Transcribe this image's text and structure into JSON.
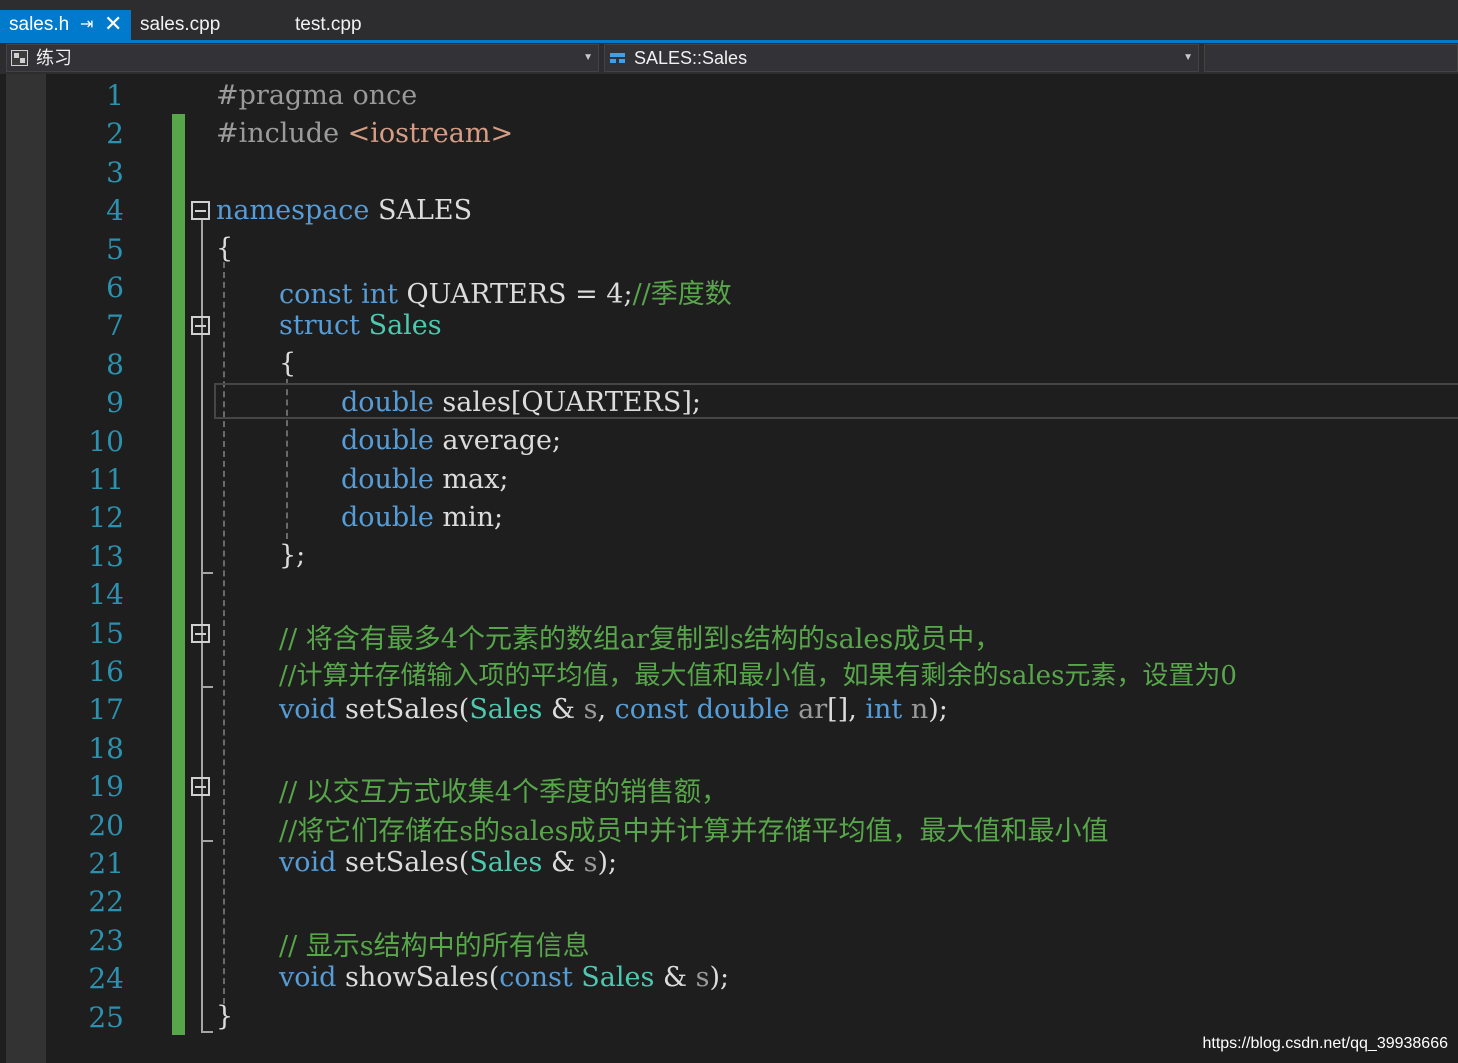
{
  "tabs": [
    {
      "label": "sales.h",
      "active": true
    },
    {
      "label": "sales.cpp",
      "active": false
    },
    {
      "label": "test.cpp",
      "active": false
    }
  ],
  "navbar": {
    "project": "练习",
    "scope": "SALES::Sales",
    "member": ""
  },
  "colors": {
    "accent": "#007acc",
    "keyword": "#569cd6",
    "type": "#4ec9b0",
    "comment": "#57a64a",
    "line_number": "#2b91af",
    "change_bar": "#57a64a"
  },
  "line_numbers": [
    "1",
    "2",
    "3",
    "4",
    "5",
    "6",
    "7",
    "8",
    "9",
    "10",
    "11",
    "12",
    "13",
    "14",
    "15",
    "16",
    "17",
    "18",
    "19",
    "20",
    "21",
    "22",
    "23",
    "24",
    "25"
  ],
  "code": {
    "l1": {
      "pre": "#pragma",
      "rest": " once"
    },
    "l2": {
      "pre": "#include",
      "str": " <iostream>"
    },
    "l4": {
      "kw": "namespace",
      "rest": " SALES"
    },
    "l5": {
      "text": "{"
    },
    "l6": {
      "kw1": "const",
      "kw2": " int",
      "rest": " QUARTERS = 4;",
      "cm": "//季度数"
    },
    "l7": {
      "kw": "struct",
      "ty": " Sales"
    },
    "l8": {
      "text": "{"
    },
    "l9": {
      "kw": "double",
      "rest": " sales[QUARTERS];"
    },
    "l10": {
      "kw": "double",
      "rest": " average;"
    },
    "l11": {
      "kw": "double",
      "rest": " max;"
    },
    "l12": {
      "kw": "double",
      "rest": " min;"
    },
    "l13": {
      "text": "};"
    },
    "l15": {
      "cm": "// 将含有最多4个元素的数组ar复制到s结构的sales成员中，"
    },
    "l16": {
      "cm": "//计算并存储输入项的平均值，最大值和最小值，如果有剩余的sales元素，设置为0"
    },
    "l17": {
      "kw": "void",
      "fn": " setSales(",
      "ty": "Sales",
      "a1": " & ",
      "p1": "s",
      "a2": ", ",
      "kw2": "const",
      "kw3": " double",
      "p2": " ar",
      "a3": "[], ",
      "kw4": "int",
      "p3": " n",
      "a4": ");"
    },
    "l19": {
      "cm": "// 以交互方式收集4个季度的销售额，"
    },
    "l20": {
      "cm": "//将它们存储在s的sales成员中并计算并存储平均值，最大值和最小值"
    },
    "l21": {
      "kw": "void",
      "fn": " setSales(",
      "ty": "Sales",
      "a1": " & ",
      "p1": "s",
      "a2": ");"
    },
    "l23": {
      "cm": "// 显示s结构中的所有信息"
    },
    "l24": {
      "kw": "void",
      "fn": " showSales(",
      "kw2": "const",
      "ty": " Sales",
      "a1": " & ",
      "p1": "s",
      "a2": ");"
    },
    "l25": {
      "text": "}"
    }
  },
  "watermark": "https://blog.csdn.net/qq_39938666"
}
